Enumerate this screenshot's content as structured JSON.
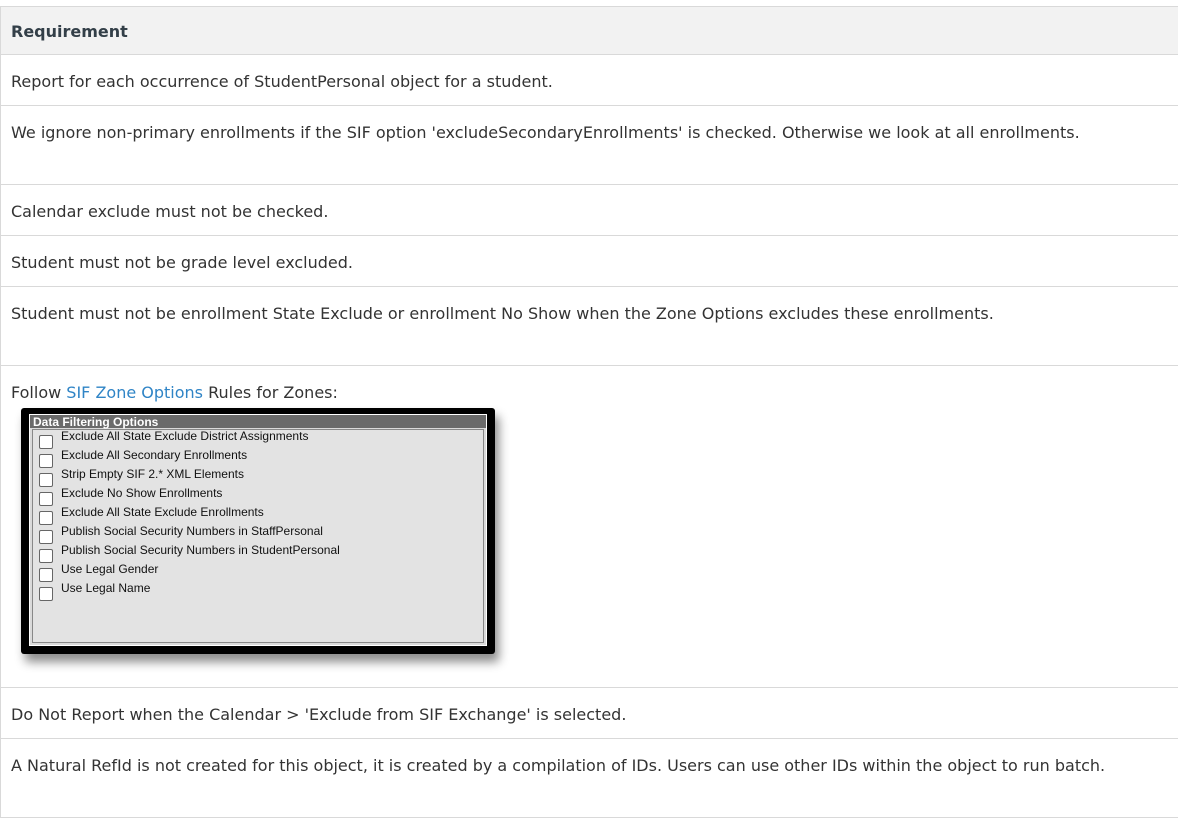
{
  "table": {
    "header": "Requirement",
    "rows": [
      "Report for each occurrence of StudentPersonal object for a student.",
      "We ignore non-primary enrollments if the SIF option 'excludeSecondaryEnrollments' is checked.  Otherwise we look at all enrollments.",
      "Calendar exclude must not be checked.",
      "Student must not be grade level excluded.",
      "Student must not be enrollment State Exclude or enrollment No Show when the Zone Options excludes these enrollments.",
      "",
      "Do Not Report when the Calendar > 'Exclude from SIF Exchange' is selected.",
      "A Natural RefId is not created for this object, it is created by a compilation of IDs. Users can use other IDs within the object to run batch."
    ],
    "zone_row": {
      "prefix": "Follow ",
      "link": "SIF Zone Options",
      "suffix": " Rules for Zones:"
    }
  },
  "screenshot": {
    "title": "Data Filtering Options",
    "options": [
      "Exclude All State Exclude District Assignments",
      "Exclude All Secondary Enrollments",
      "Strip Empty SIF 2.* XML Elements",
      "Exclude No Show Enrollments",
      "Exclude All State Exclude Enrollments",
      "Publish Social Security Numbers in StaffPersonal",
      "Publish Social Security Numbers in StudentPersonal",
      "Use Legal Gender",
      "Use Legal Name"
    ]
  }
}
